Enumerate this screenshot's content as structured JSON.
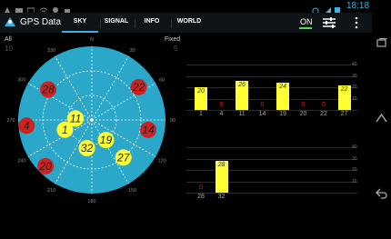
{
  "status": {
    "time": "18:18",
    "left_icons": [
      "warning-icon",
      "photo-icon",
      "wifi-icon",
      "pin-icon",
      "bag-icon"
    ],
    "right_icons": [
      "headset-icon",
      "signal-icon",
      "battery-icon"
    ]
  },
  "actionbar": {
    "title": "GPS Data",
    "tabs": [
      "SKY",
      "SIGNAL",
      "INFO",
      "WORLD"
    ],
    "active_tab": "SKY",
    "toggle_label": "ON",
    "accent": "#33b5e5"
  },
  "sky": {
    "top_left_label": "All",
    "top_left_count": "10",
    "top_right_label": "Fixed",
    "top_right_count": "5",
    "azimuth_labels": [
      "N",
      "30",
      "60",
      "90",
      "120",
      "150",
      "180",
      "210",
      "240",
      "270",
      "300",
      "330"
    ],
    "satellites": [
      {
        "prn": "1",
        "az": 250,
        "el": 55,
        "color": "yellow"
      },
      {
        "prn": "4",
        "az": 265,
        "el": 10,
        "color": "red"
      },
      {
        "prn": "11",
        "az": 275,
        "el": 70,
        "color": "yellow"
      },
      {
        "prn": "14",
        "az": 100,
        "el": 20,
        "color": "red"
      },
      {
        "prn": "19",
        "az": 145,
        "el": 60,
        "color": "yellow"
      },
      {
        "prn": "20",
        "az": 225,
        "el": 10,
        "color": "red"
      },
      {
        "prn": "22",
        "az": 55,
        "el": 20,
        "color": "red"
      },
      {
        "prn": "27",
        "az": 140,
        "el": 30,
        "color": "yellow"
      },
      {
        "prn": "28",
        "az": 305,
        "el": 25,
        "color": "red"
      },
      {
        "prn": "32",
        "az": 190,
        "el": 55,
        "color": "yellow"
      }
    ]
  },
  "signal": {
    "scale_labels": [
      "40",
      "30",
      "20",
      "10"
    ],
    "row1": [
      {
        "prn": "1",
        "snr": 20
      },
      {
        "prn": "4",
        "snr": 0
      },
      {
        "prn": "11",
        "snr": 26
      },
      {
        "prn": "14",
        "snr": 0
      },
      {
        "prn": "19",
        "snr": 24
      },
      {
        "prn": "20",
        "snr": 0
      },
      {
        "prn": "22",
        "snr": 0
      },
      {
        "prn": "27",
        "snr": 22
      }
    ],
    "row2": [
      {
        "prn": "28",
        "snr": 0
      },
      {
        "prn": "32",
        "snr": 28
      }
    ]
  },
  "colors": {
    "sky_disc": "#2aa7c9",
    "sat_yellow": "#ffff33",
    "sat_red": "#cc2222",
    "bar_yellow": "#ffff33"
  }
}
